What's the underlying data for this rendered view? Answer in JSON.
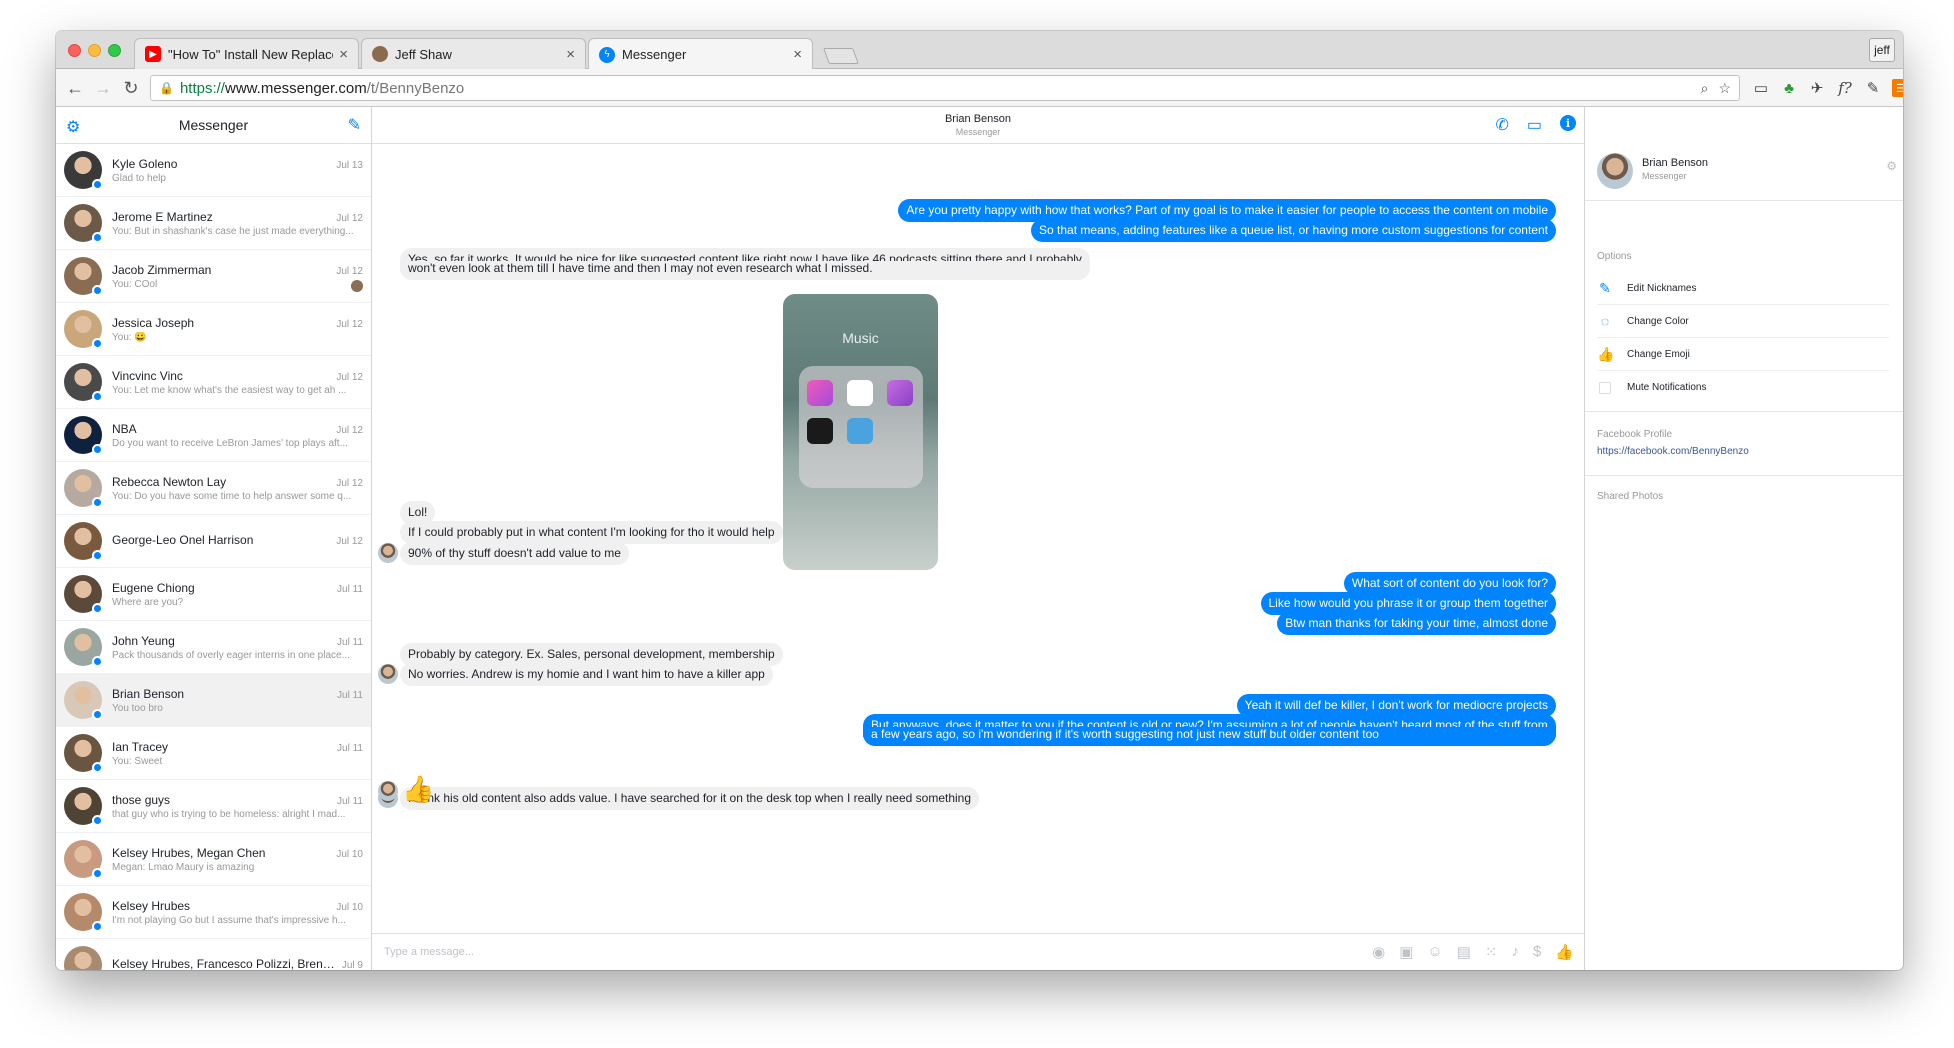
{
  "browser": {
    "tabs": [
      {
        "title": "\"How To\" Install New Replacement",
        "favicon": "youtube-icon",
        "color": "#ff0000"
      },
      {
        "title": "Jeff Shaw",
        "favicon": "avatar-icon",
        "color": "#8b6b4e"
      },
      {
        "title": "Messenger",
        "favicon": "messenger-icon",
        "color": "#0084ff"
      }
    ],
    "profile": "jeff",
    "url": {
      "scheme": "https://",
      "host": "www.messenger.com",
      "path": "/t/BennyBenzo"
    }
  },
  "sidebar": {
    "title": "Messenger",
    "conversations": [
      {
        "name": "Kyle Goleno",
        "date": "Jul 13",
        "snippet": "Glad to help"
      },
      {
        "name": "Jerome E Martinez",
        "date": "Jul 12",
        "snippet": "You: But in shashank's case he just made everything..."
      },
      {
        "name": "Jacob Zimmerman",
        "date": "Jul 12",
        "snippet": "You: COol"
      },
      {
        "name": "Jessica Joseph",
        "date": "Jul 12",
        "snippet": "You: 😀"
      },
      {
        "name": "Vincvinc Vinc",
        "date": "Jul 12",
        "snippet": "You: Let me know what's the easiest way to get ah ..."
      },
      {
        "name": "NBA",
        "date": "Jul 12",
        "snippet": "Do you want to receive LeBron James' top plays aft..."
      },
      {
        "name": "Rebecca Newton Lay",
        "date": "Jul 12",
        "snippet": "You: Do you have some time to help answer some q..."
      },
      {
        "name": "George-Leo Onel Harrison",
        "date": "Jul 12",
        "snippet": ""
      },
      {
        "name": "Eugene Chiong",
        "date": "Jul 11",
        "snippet": "Where are you?"
      },
      {
        "name": "John Yeung",
        "date": "Jul 11",
        "snippet": "Pack thousands of overly eager interns in one place..."
      },
      {
        "name": "Brian Benson",
        "date": "Jul 11",
        "snippet": "You too bro"
      },
      {
        "name": "Ian Tracey",
        "date": "Jul 11",
        "snippet": "You: Sweet"
      },
      {
        "name": "those guys",
        "date": "Jul 11",
        "snippet": "that guy who is trying to be homeless: alright I mad..."
      },
      {
        "name": "Kelsey Hrubes, Megan Chen",
        "date": "Jul 10",
        "snippet": "Megan: Lmao Maury is amazing"
      },
      {
        "name": "Kelsey Hrubes",
        "date": "Jul 10",
        "snippet": "I'm not playing Go but I assume that's impressive h..."
      },
      {
        "name": "Kelsey Hrubes, Francesco Polizzi, Brendon...",
        "date": "Jul 9",
        "snippet": ""
      }
    ]
  },
  "chat": {
    "contact_name": "Brian Benson",
    "contact_sub": "Messenger",
    "composer_placeholder": "Type a message...",
    "photo_folder_title": "Music",
    "messages": [
      {
        "dir": "out",
        "text": "Are you pretty happy with how that works? Part of my goal is to make it easier for people to access the content on mobile"
      },
      {
        "dir": "out",
        "text": "So that means, adding features like a queue list, or having more custom suggestions for content"
      },
      {
        "dir": "in",
        "text": "Yes, so far it works. It would be nice for like suggested content like right now I have like 46 podcasts sitting there and I probably"
      },
      {
        "dir": "in",
        "text": "won't even look at them till I have time and then I may not even research what I missed."
      },
      {
        "dir": "in",
        "text": "Lol!"
      },
      {
        "dir": "in",
        "text": "If I could probably put in what content I'm looking for tho it would help"
      },
      {
        "dir": "in",
        "text": "90% of thy stuff doesn't add value to me"
      },
      {
        "dir": "out",
        "text": "What sort of content do you look for?"
      },
      {
        "dir": "out",
        "text": "Like how would you phrase it or group them together"
      },
      {
        "dir": "out",
        "text": "Btw man thanks for taking your time, almost done"
      },
      {
        "dir": "in",
        "text": "Probably by category. Ex. Sales, personal development, membership"
      },
      {
        "dir": "in",
        "text": "No worries. Andrew is my homie and I want him to have a killer app"
      },
      {
        "dir": "out",
        "text": "Yeah it will def be killer, I don't work for mediocre projects"
      },
      {
        "dir": "out",
        "text": "But anyways, does it matter to you if the content is old or new? I'm assuming a lot of people haven't heard most of the stuff from"
      },
      {
        "dir": "out",
        "text": "a few years ago, so i'm wondering if it's worth suggesting not just new stuff but older content too"
      },
      {
        "dir": "in",
        "text": "I think his old content also adds value. I have searched for it on the desk top when I really need something"
      }
    ]
  },
  "info_panel": {
    "name": "Brian Benson",
    "sub": "Messenger",
    "options_label": "Options",
    "options": [
      {
        "label": "Edit Nicknames",
        "icon": "pencil-icon"
      },
      {
        "label": "Change Color",
        "icon": "palette-icon"
      },
      {
        "label": "Change Emoji",
        "icon": "thumbs-up-icon"
      },
      {
        "label": "Mute Notifications",
        "icon": "checkbox"
      }
    ],
    "profile_label": "Facebook Profile",
    "profile_link": "https://facebook.com/BennyBenzo",
    "shared_label": "Shared Photos"
  },
  "colors": {
    "accent": "#0084ff",
    "incoming_bubble": "#f1f0f0"
  }
}
